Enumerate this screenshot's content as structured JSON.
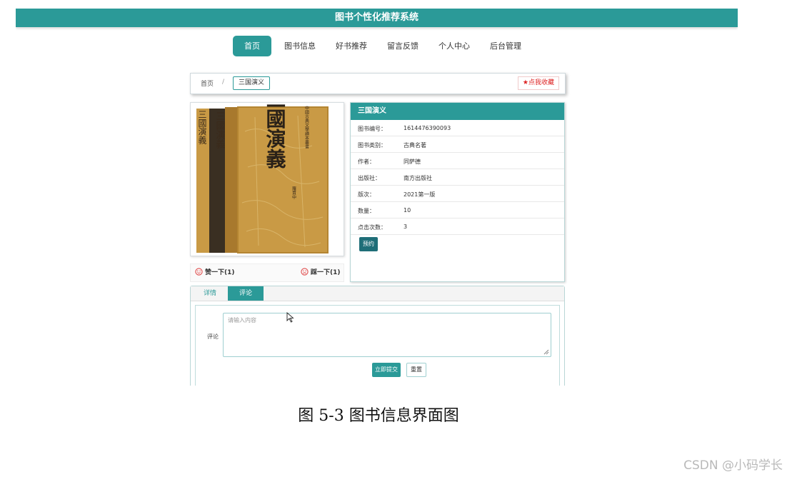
{
  "app": {
    "title": "图书个性化推荐系统"
  },
  "nav": {
    "items": [
      {
        "label": "首页"
      },
      {
        "label": "图书信息"
      },
      {
        "label": "好书推荐"
      },
      {
        "label": "留言反馈"
      },
      {
        "label": "个人中心"
      },
      {
        "label": "后台管理"
      }
    ],
    "active_label": "首页"
  },
  "breadcrumb": {
    "home": "首页",
    "separator": "/",
    "current": "三国演义"
  },
  "favorite_button": {
    "icon": "star-icon",
    "label": "点我收藏"
  },
  "cover": {
    "title_large": "三國演義",
    "spine_title": "三國演義",
    "series_text": "中國古典文學讀本叢書",
    "author_text": "羅貫中"
  },
  "votes": {
    "like": {
      "icon": "smile-face-icon",
      "label": "赞一下(1)"
    },
    "dislike": {
      "icon": "sad-face-icon",
      "label": "踩一下(1)"
    }
  },
  "info": {
    "title": "三国演义",
    "rows": [
      {
        "key": "图书编号：",
        "value": "1614476390093"
      },
      {
        "key": "图书类别：",
        "value": "古典名著"
      },
      {
        "key": "作者：",
        "value": "同萨德"
      },
      {
        "key": "出版社：",
        "value": "南方出版社"
      },
      {
        "key": "版次：",
        "value": "2021第一版"
      },
      {
        "key": "数量：",
        "value": "10"
      },
      {
        "key": "点击次数：",
        "value": "3"
      }
    ],
    "reserve_label": "预约"
  },
  "tabs": {
    "items": [
      {
        "label": "详情"
      },
      {
        "label": "评论"
      }
    ],
    "active": "评论"
  },
  "comment": {
    "label": "评论",
    "placeholder": "请输入内容",
    "submit_label": "立即提交",
    "reset_label": "重置"
  },
  "figure": {
    "caption": "图 5-3 图书信息界面图"
  },
  "watermark": "CSDN @小码学长",
  "colors": {
    "accent": "#2b9a98",
    "accent_dark": "#1f6e78",
    "favorite": "#dd2222"
  }
}
